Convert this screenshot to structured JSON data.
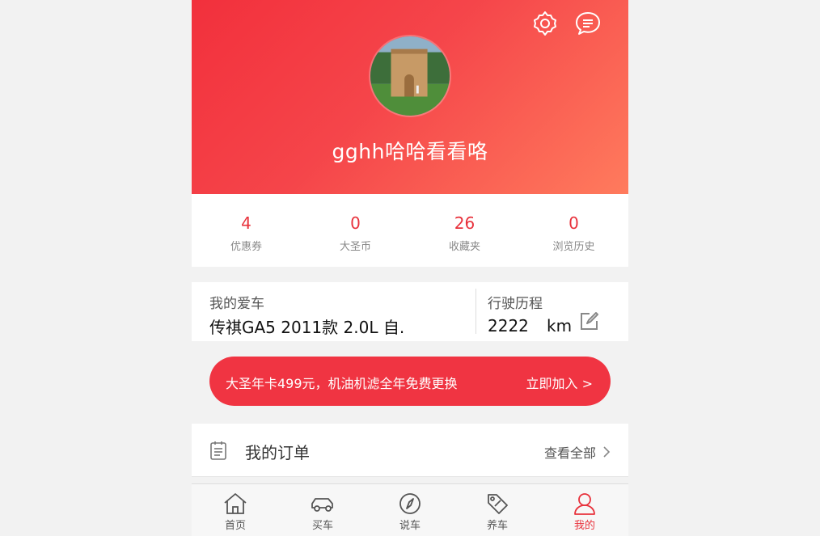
{
  "profile": {
    "username": "gghh哈哈看看咯"
  },
  "header_icons": [
    "gear-icon",
    "message-icon"
  ],
  "stats": [
    {
      "value": "4",
      "label": "优惠券"
    },
    {
      "value": "0",
      "label": "大圣币"
    },
    {
      "value": "26",
      "label": "收藏夹"
    },
    {
      "value": "0",
      "label": "浏览历史"
    }
  ],
  "car": {
    "label": "我的爱车",
    "model": "传祺GA5 2011款 2.0L 自.",
    "mileage_label": "行驶历程",
    "mileage_value": "2222",
    "mileage_unit": "km"
  },
  "promo": {
    "text": "大圣年卡499元，机油机滤全年免费更换",
    "action": "立即加入 >"
  },
  "orders": {
    "title": "我的订单",
    "view_all": "查看全部"
  },
  "tabbar": [
    {
      "label": "首页",
      "icon": "home-icon"
    },
    {
      "label": "买车",
      "icon": "car-icon"
    },
    {
      "label": "说车",
      "icon": "compass-icon"
    },
    {
      "label": "养车",
      "icon": "tag-icon"
    },
    {
      "label": "我的",
      "icon": "user-icon",
      "active": true
    }
  ],
  "colors": {
    "accent": "#e8323c",
    "header_start": "#f2303c",
    "header_end": "#ff7b5d"
  }
}
